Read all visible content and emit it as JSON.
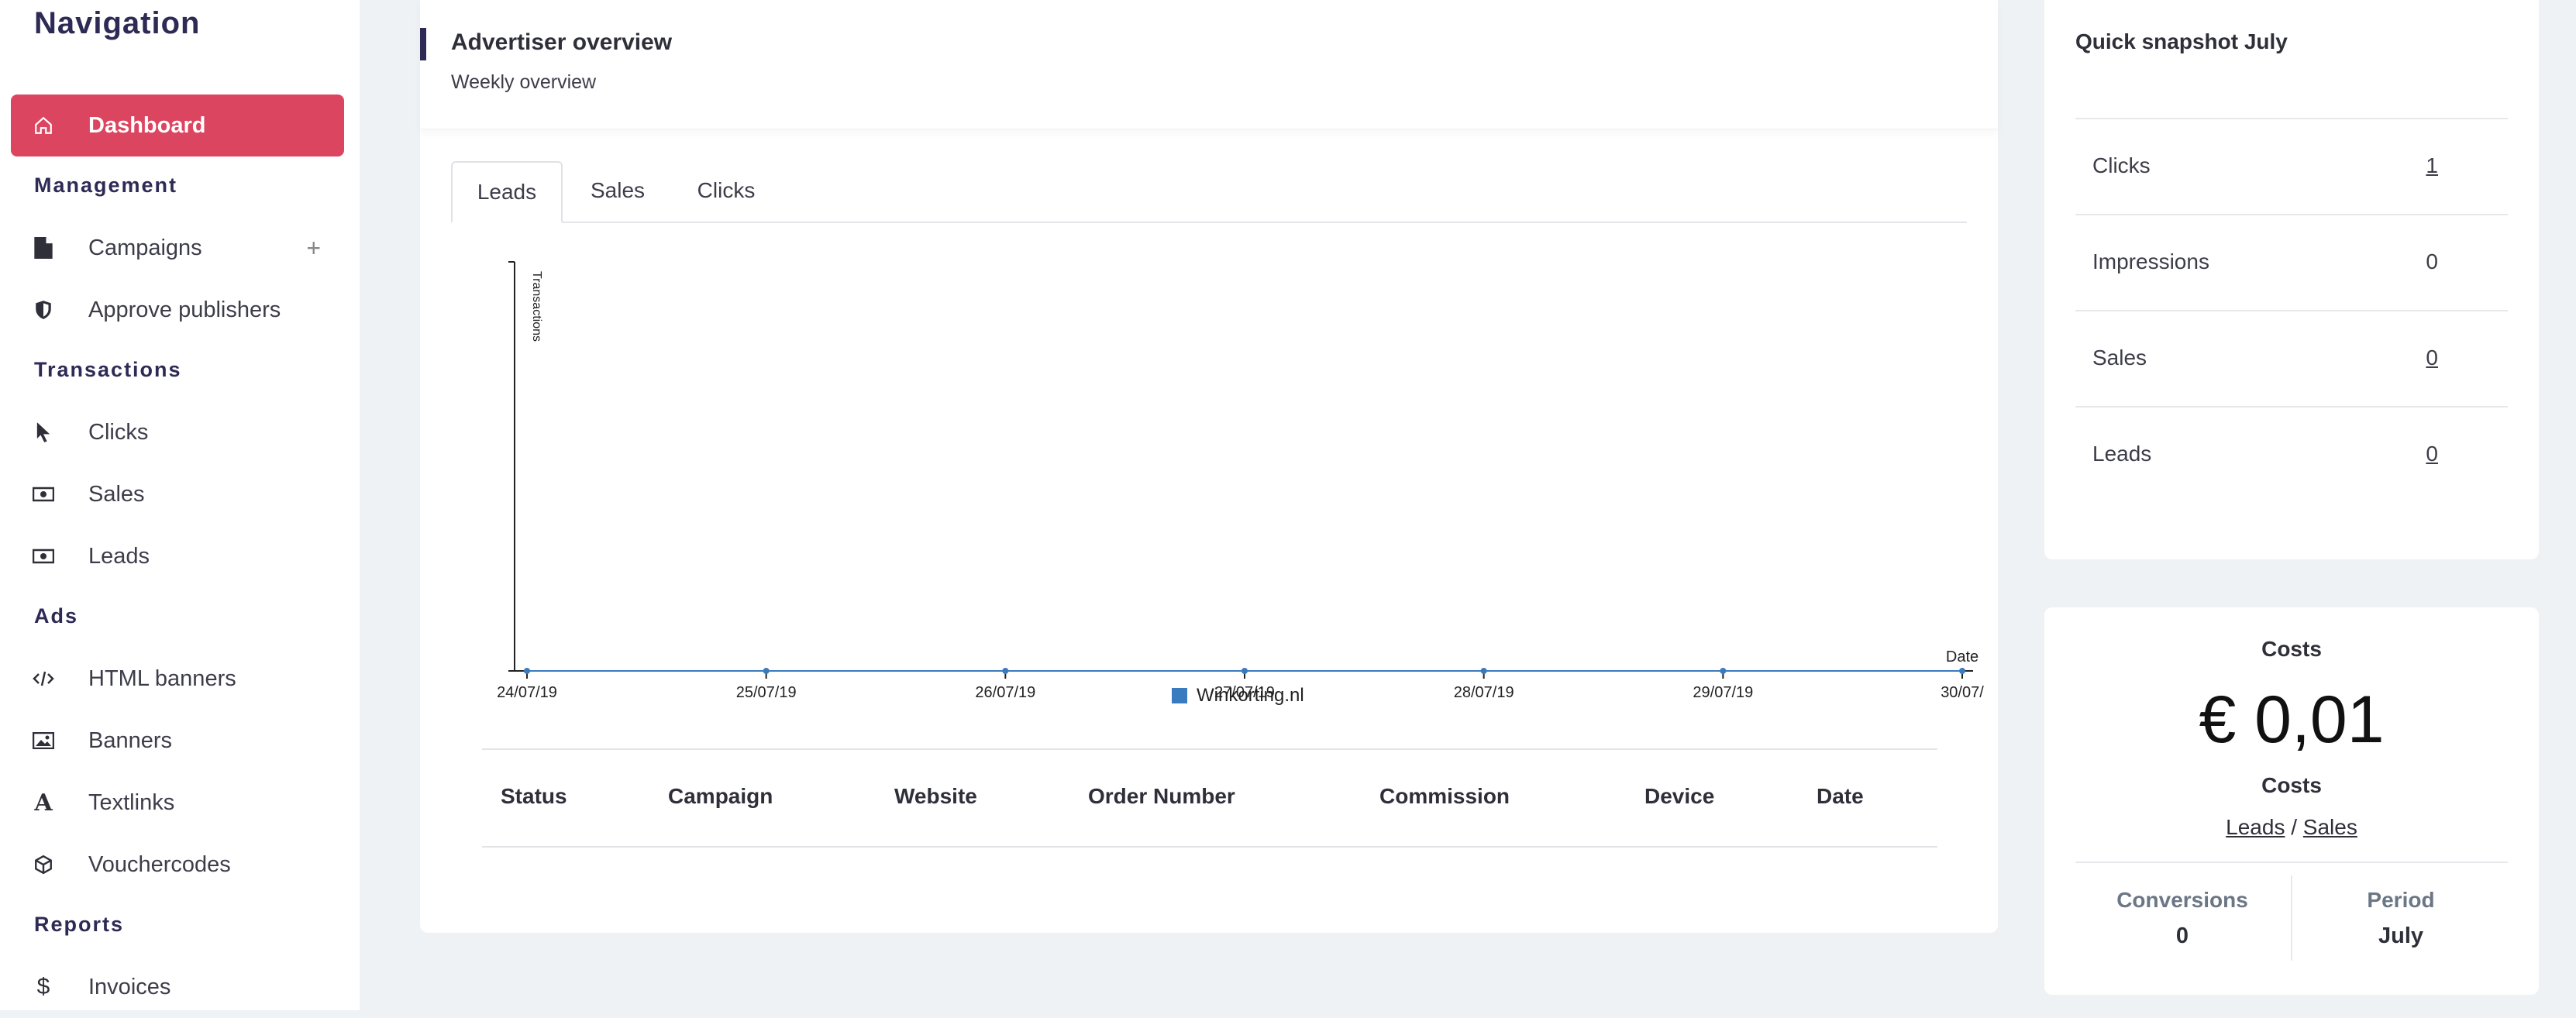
{
  "sidebar": {
    "title": "Navigation",
    "items": [
      {
        "label": "Dashboard",
        "icon": "home-icon"
      },
      {
        "label": "Campaigns",
        "icon": "file-icon"
      },
      {
        "label": "Approve publishers",
        "icon": "shield-icon"
      },
      {
        "label": "Clicks",
        "icon": "cursor-icon"
      },
      {
        "label": "Sales",
        "icon": "money-icon"
      },
      {
        "label": "Leads",
        "icon": "money-icon"
      },
      {
        "label": "HTML banners",
        "icon": "code-icon"
      },
      {
        "label": "Banners",
        "icon": "image-icon"
      },
      {
        "label": "Textlinks",
        "icon": "text-icon"
      },
      {
        "label": "Vouchercodes",
        "icon": "cube-icon"
      },
      {
        "label": "Invoices",
        "icon": "dollar-icon"
      }
    ],
    "sections": [
      "Management",
      "Transactions",
      "Ads",
      "Reports"
    ],
    "campaigns_add": "+"
  },
  "overview": {
    "title": "Advertiser overview",
    "subtitle": "Weekly overview",
    "tabs": [
      "Leads",
      "Sales",
      "Clicks"
    ],
    "active_tab": "Leads"
  },
  "chart_data": {
    "type": "line",
    "ylabel": "Transactions",
    "xlabel": "Date",
    "x": [
      "24/07/19",
      "25/07/19",
      "26/07/19",
      "27/07/19",
      "28/07/19",
      "29/07/19",
      "30/07/"
    ],
    "series": [
      {
        "name": "Winkorting.nl",
        "values": [
          0,
          0,
          0,
          0,
          0,
          0,
          0
        ],
        "color": "#3a7bbf"
      }
    ]
  },
  "table": {
    "columns": [
      "Status",
      "Campaign",
      "Website",
      "Order Number",
      "Commission",
      "Device",
      "Date"
    ]
  },
  "snapshot": {
    "title": "Quick snapshot July",
    "rows": [
      {
        "label": "Clicks",
        "value": "1"
      },
      {
        "label": "Impressions",
        "value": "0"
      },
      {
        "label": "Sales",
        "value": "0"
      },
      {
        "label": "Leads",
        "value": "0"
      }
    ]
  },
  "costs": {
    "title": "Costs",
    "amount": "€ 0,01",
    "sublabel": "Costs",
    "link_leads": "Leads",
    "separator": "/",
    "link_sales": "Sales",
    "conversions_label": "Conversions",
    "conversions_value": "0",
    "period_label": "Period",
    "period_value": "July"
  },
  "colors": {
    "accent": "#dc4560",
    "brand": "#2d2b55",
    "series": "#3a7bbf"
  }
}
